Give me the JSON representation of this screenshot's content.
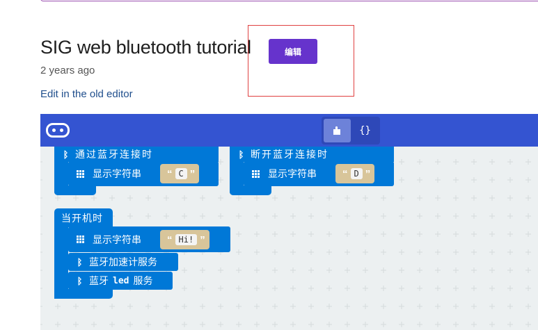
{
  "project": {
    "title": "SIG web bluetooth tutorial",
    "edit_label": "编辑",
    "age": "2 years ago",
    "old_editor_link": "Edit in the old editor"
  },
  "editor": {
    "toggle": {
      "blocks_icon": "puzzle-icon",
      "code_label": "{}"
    },
    "blocks": {
      "on_connected": {
        "event_label": "通过蓝牙连接时",
        "show_label": "显示字符串",
        "string_value": "C"
      },
      "on_disconnected": {
        "event_label": "断开蓝牙连接时",
        "show_label": "显示字符串",
        "string_value": "D"
      },
      "on_start": {
        "event_label": "当开机时",
        "show_label": "显示字符串",
        "string_value": "Hi!",
        "accel_service_label": "蓝牙加速计服务",
        "led_service_prefix": "蓝牙",
        "led_service_keyword": "led",
        "led_service_suffix": "服务"
      }
    }
  },
  "colors": {
    "accent_purple": "#6633cc",
    "toolbar_blue": "#3454d1",
    "block_blue": "#0078d7",
    "text_block": "#d8c59a",
    "workspace_bg": "#ecf0f1"
  }
}
